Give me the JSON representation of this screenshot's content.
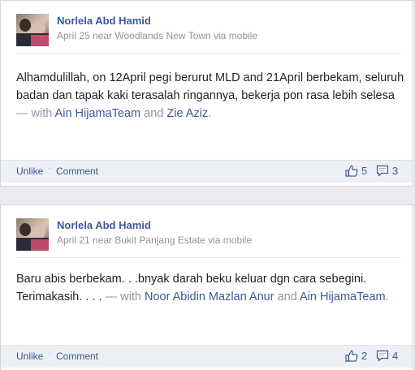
{
  "posts": [
    {
      "author": "Norlela Abd Hamid",
      "meta": "April 25 near Woodlands New Town via mobile",
      "text": "Alhamdulillah, on 12April pegi berurut MLD and 21April berbekam, seluruh badan dan tapak kaki terasalah ringannya, bekerja pon rasa lebih selesa",
      "with_label": " — with ",
      "tag1": "Ain HijamaTeam",
      "and_label": " and ",
      "tag2": "Zie Aziz",
      "end": ".",
      "unlike": "Unlike",
      "dot": "·",
      "comment": "Comment",
      "likes": "5",
      "comments": "3"
    },
    {
      "author": "Norlela Abd Hamid",
      "meta": "April 21 near Bukit Panjang Estate via mobile",
      "text": "Baru abis berbekam. . .bnyak darah beku keluar dgn cara sebegini. Terimakasih. . . .",
      "with_label": " — with ",
      "tag1": "Noor Abidin Mazlan Anur",
      "and_label": " and ",
      "tag2": "Ain HijamaTeam",
      "end": ".",
      "unlike": "Unlike",
      "dot": "·",
      "comment": "Comment",
      "likes": "2",
      "comments": "4"
    }
  ],
  "icons": {
    "like": "thumbs-up-icon",
    "comment": "comment-bubble-icon"
  },
  "colors": {
    "link": "#3b5998",
    "meta": "#90949c",
    "footer_bg": "#edf0f5"
  }
}
